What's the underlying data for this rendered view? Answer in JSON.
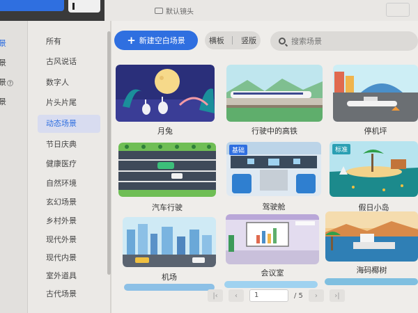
{
  "topbar": {
    "default_camera_label": "默认镜头"
  },
  "far_left": {
    "items": [
      {
        "label": "景",
        "active": true
      },
      {
        "label": "景",
        "active": false
      },
      {
        "label": "景",
        "active": false
      },
      {
        "label": "景",
        "active": false
      }
    ]
  },
  "categories": [
    {
      "label": "所有",
      "active": false
    },
    {
      "label": "古风说话",
      "active": false
    },
    {
      "label": "数字人",
      "active": false
    },
    {
      "label": "片头片尾",
      "active": false
    },
    {
      "label": "动态场景",
      "active": true
    },
    {
      "label": "节日庆典",
      "active": false
    },
    {
      "label": "健康医疗",
      "active": false
    },
    {
      "label": "自然环境",
      "active": false
    },
    {
      "label": "玄幻场景",
      "active": false
    },
    {
      "label": "乡村外景",
      "active": false
    },
    {
      "label": "现代外景",
      "active": false
    },
    {
      "label": "现代内景",
      "active": false
    },
    {
      "label": "室外道具",
      "active": false
    },
    {
      "label": "古代场景",
      "active": false
    }
  ],
  "toolbar": {
    "new_button_label": "新建空白场景",
    "orientation_landscape": "横板",
    "orientation_portrait": "竖版",
    "search_placeholder": "搜索场景"
  },
  "scenes": [
    {
      "label": "月兔",
      "badge": ""
    },
    {
      "label": "行驶中的高铁",
      "badge": ""
    },
    {
      "label": "停机坪",
      "badge": ""
    },
    {
      "label": "汽车行驶",
      "badge": ""
    },
    {
      "label": "驾驶舱",
      "badge": "基础"
    },
    {
      "label": "假日小岛",
      "badge": "标准"
    },
    {
      "label": "机场",
      "badge": ""
    },
    {
      "label": "会议室",
      "badge": ""
    },
    {
      "label": "海码椰树",
      "badge": ""
    }
  ],
  "pagination": {
    "current_page": "1",
    "total_pages": "/ 5"
  }
}
